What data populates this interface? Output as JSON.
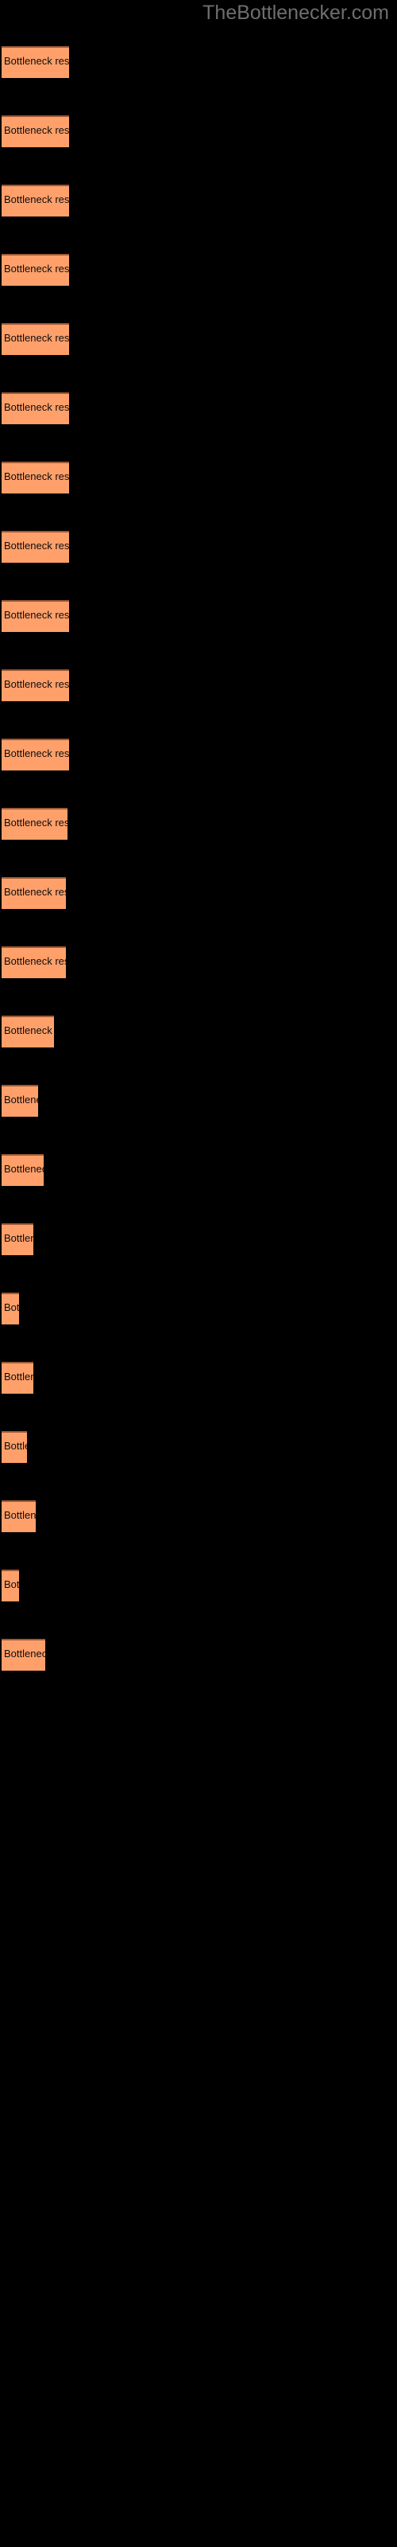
{
  "watermark": {
    "text": "TheBottlenecker.com",
    "color": "#6e6e6e"
  },
  "style": {
    "background": "#000000",
    "bar_fill": "#ffa06a",
    "bar_border_top": "#9e5b37",
    "bar_text": "#0d0d0d"
  },
  "chart_data": {
    "type": "bar",
    "orientation": "horizontal",
    "title": "",
    "subtitle": "",
    "xlabel": "",
    "ylabel": "",
    "grid": false,
    "legend": null,
    "axis_labels_visible": false,
    "tick_labels_visible": false,
    "bar_label_template": "Bottleneck result",
    "xlim": [
      0,
      100
    ],
    "note": "Bar lengths measured in pixels of drawn width; each bar is annotated with the clipped visible text 'Bottleneck result'.",
    "categories": [
      "Bottleneck result 1",
      "Bottleneck result 2",
      "Bottleneck result 3",
      "Bottleneck result 4",
      "Bottleneck result 5",
      "Bottleneck result 6",
      "Bottleneck result 7",
      "Bottleneck result 8",
      "Bottleneck result 9",
      "Bottleneck result 10",
      "Bottleneck result 11",
      "Bottleneck result 12",
      "Bottleneck result 13",
      "Bottleneck result 14",
      "Bottleneck result 15",
      "Bottleneck result 16",
      "Bottleneck result 17",
      "Bottleneck result 18",
      "Bottleneck result 19",
      "Bottleneck result 20",
      "Bottleneck result 21",
      "Bottleneck result 22",
      "Bottleneck result 23",
      "Bottleneck result 24"
    ],
    "values": [
      85,
      85,
      85,
      85,
      85,
      85,
      85,
      85,
      85,
      85,
      85,
      83,
      81,
      81,
      66,
      46,
      53,
      40,
      22,
      40,
      32,
      43,
      22,
      55
    ]
  },
  "bars": [
    {
      "label": "Bottleneck result",
      "width": 85,
      "top": 58
    },
    {
      "label": "Bottleneck result",
      "width": 85,
      "top": 145
    },
    {
      "label": "Bottleneck result",
      "width": 85,
      "top": 232
    },
    {
      "label": "Bottleneck result",
      "width": 85,
      "top": 319
    },
    {
      "label": "Bottleneck result",
      "width": 85,
      "top": 406
    },
    {
      "label": "Bottleneck result",
      "width": 85,
      "top": 493
    },
    {
      "label": "Bottleneck result",
      "width": 85,
      "top": 580
    },
    {
      "label": "Bottleneck result",
      "width": 85,
      "top": 667
    },
    {
      "label": "Bottleneck result",
      "width": 85,
      "top": 754
    },
    {
      "label": "Bottleneck result",
      "width": 85,
      "top": 841
    },
    {
      "label": "Bottleneck result",
      "width": 85,
      "top": 928
    },
    {
      "label": "Bottleneck result",
      "width": 83,
      "top": 1015
    },
    {
      "label": "Bottleneck result",
      "width": 81,
      "top": 1102
    },
    {
      "label": "Bottleneck result",
      "width": 81,
      "top": 1189
    },
    {
      "label": "Bottleneck result",
      "width": 66,
      "top": 1276
    },
    {
      "label": "Bottleneck result",
      "width": 46,
      "top": 1363
    },
    {
      "label": "Bottleneck result",
      "width": 53,
      "top": 1450
    },
    {
      "label": "Bottleneck result",
      "width": 40,
      "top": 1537
    },
    {
      "label": "Bottleneck result",
      "width": 22,
      "top": 1624
    },
    {
      "label": "Bottleneck result",
      "width": 40,
      "top": 1711
    },
    {
      "label": "Bottleneck result",
      "width": 32,
      "top": 1798
    },
    {
      "label": "Bottleneck result",
      "width": 43,
      "top": 1885
    },
    {
      "label": "Bottleneck result",
      "width": 22,
      "top": 1972
    },
    {
      "label": "Bottleneck result",
      "width": 55,
      "top": 2059
    }
  ]
}
